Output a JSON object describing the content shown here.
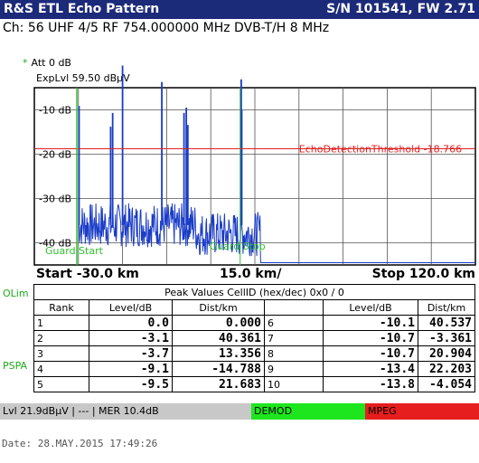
{
  "header": {
    "title": "R&S ETL Echo Pattern",
    "serial": "S/N 101541, FW 2.71"
  },
  "channel_line": "Ch:  56  UHF 4/5  RF 754.000000 MHz  DVB-T/H  8 MHz",
  "att": {
    "marker": "*",
    "label": "Att   0 dB"
  },
  "explvl": "ExpLvl 59.50 dBµV",
  "colors": {
    "trace": "#1a3cc8",
    "threshold": "#e02020",
    "guard": "#30c030",
    "title_bg": "#1c2a7a"
  },
  "chart_data": {
    "type": "line",
    "xlim": [
      -30,
      120
    ],
    "ylim": [
      -45,
      -5
    ],
    "ytick_labels": [
      "-10 dB",
      "-20 dB",
      "-30 dB",
      "-40 dB"
    ],
    "grid": true,
    "threshold": {
      "label": "EchoDetectionThreshold -18.766",
      "value": -18.766
    },
    "guard_start": {
      "label": "Guard Start",
      "x": -30
    },
    "guard_stop": {
      "label": "Guard Stop",
      "x": 40
    },
    "peaks_x": [
      0,
      40.361,
      13.356,
      -14.788,
      21.683,
      40.537,
      -3.361,
      20.904,
      22.203,
      -4.054
    ],
    "peaks_y": [
      0,
      -3.1,
      -3.7,
      -9.1,
      -9.5,
      -10.1,
      -10.7,
      -10.7,
      -13.4,
      -13.8
    ],
    "noise_floor": -36
  },
  "axis": {
    "start": "Start -30.0 km",
    "div": "15.0 km/",
    "stop": "Stop 120.0 km"
  },
  "side": {
    "olim": "OLim",
    "pspa": "PSPA"
  },
  "table": {
    "title": "Peak Values    CellID (hex/dec)  0x0 / 0",
    "headers": [
      "Rank",
      "Level/dB",
      "Dist/km",
      "",
      "Level/dB",
      "Dist/km"
    ],
    "rows": [
      [
        "1",
        "0.0",
        "0.000",
        "6",
        "-10.1",
        "40.537"
      ],
      [
        "2",
        "-3.1",
        "40.361",
        "7",
        "-10.7",
        "-3.361"
      ],
      [
        "3",
        "-3.7",
        "13.356",
        "8",
        "-10.7",
        "20.904"
      ],
      [
        "4",
        "-9.1",
        "-14.788",
        "9",
        "-13.4",
        "22.203"
      ],
      [
        "5",
        "-9.5",
        "21.683",
        "10",
        "-13.8",
        "-4.054"
      ]
    ]
  },
  "status": {
    "left": "Lvl 21.9dBµV | --- | MER 10.4dB",
    "demod": "DEMOD",
    "mpeg": "MPEG"
  },
  "date": "Date: 28.MAY.2015  17:49:26"
}
